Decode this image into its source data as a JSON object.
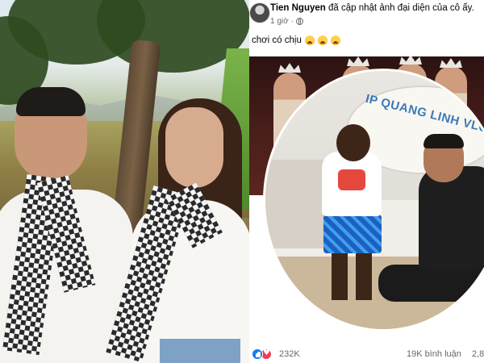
{
  "post": {
    "author": "Tien Nguyen",
    "action": "đã cập nhật ảnh đại diện của cô ấy.",
    "time": "1 giờ",
    "time_separator": "·",
    "caption": "chơi có chịu",
    "caption_emojis": [
      "crying-face-emoji",
      "crying-face-emoji",
      "crying-face-emoji"
    ],
    "photo_sign_text": "IP QUANG LINH VLOG",
    "reactions": {
      "icons": [
        "like-icon",
        "love-icon"
      ],
      "count": "232K",
      "comments": "19K bình luận",
      "shares": "2,8"
    }
  },
  "colors": {
    "facebook_blue": "#1877f2",
    "love_red": "#f33e58",
    "secondary_text": "#65676b",
    "primary_text": "#050505"
  }
}
